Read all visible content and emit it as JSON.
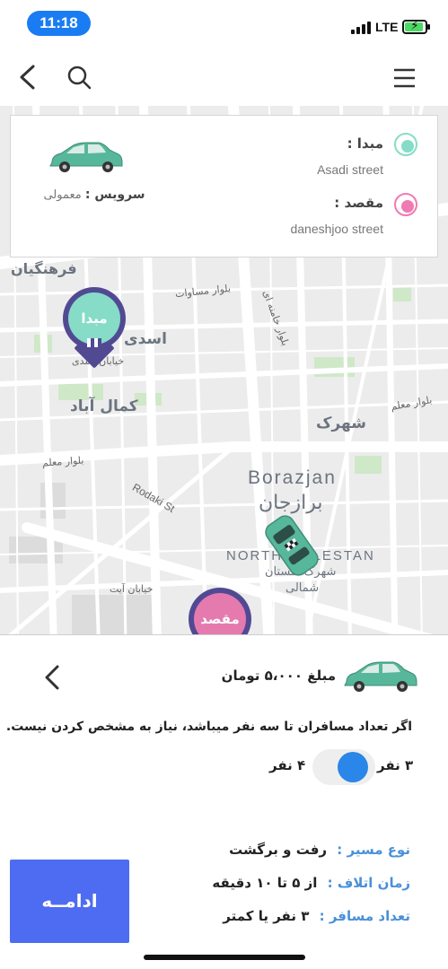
{
  "status_bar": {
    "time": "11:18",
    "network": "LTE"
  },
  "nav": {
    "back_icon": "chevron-left-icon",
    "search_icon": "search-icon",
    "menu_icon": "hamburger-menu-icon"
  },
  "route": {
    "origin_label": "مبدا :",
    "origin_value": "Asadi street",
    "destination_label": "مقصد :",
    "destination_value": "daneshjoo street",
    "service_label": "سرویس :",
    "service_value": "معمولی",
    "origin_color": "#86dcc7",
    "destination_color": "#f07ab2"
  },
  "map": {
    "labels": {
      "farhangian": "فرهنگیان",
      "asadi": "اسدی",
      "asadi_street": "خیابان اسدی",
      "kamal_abad": "کمال آباد",
      "bolvar_mosavat": "بلوار مساوات",
      "bolvar_khamenei": "بلوار خامنه ای",
      "shahrak": "شهرک",
      "bolvar_moalem_right": "بلوار معلم",
      "bolvar_moalem_left": "بلوار معلم",
      "borazjan_en": "Borazjan",
      "borazjan_fa": "برازجان",
      "rodaki": "Rodaki St",
      "north_golestan": "NORTH GOLESTAN",
      "golestan_fa_1": "شهرک گلستان",
      "golestan_fa_2": "شمالی",
      "khiaban_ayat": "خیابان آیت",
      "bolvar_top_left": "بلوار",
      "bolvar_top_right": "بلوار"
    },
    "origin_pin": {
      "label": "مبدا",
      "color": "#86dcc7"
    },
    "destination_pin": {
      "label": "مقصد",
      "color": "#e57aaf"
    }
  },
  "sheet": {
    "price": "مبلغ ۵،۰۰۰ تومان",
    "info": "اگر تعداد مسافران تا سه نفر میباشد، نیاز به مشخص کردن نیست.",
    "option_selected": "۳ نفر",
    "option_other": "۴ نفر",
    "route_type_label": "نوع مسیر :",
    "route_type_value": "رفت و برگشت",
    "wait_time_label": "زمان اتلاف :",
    "wait_time_value": "از ۵ تا ۱۰ دقیقه",
    "passengers_label": "تعداد مسافر :",
    "passengers_value": "۳ نفر یا کمتر",
    "continue_label": "ادامــه",
    "accent_color": "#4e6cf2"
  }
}
